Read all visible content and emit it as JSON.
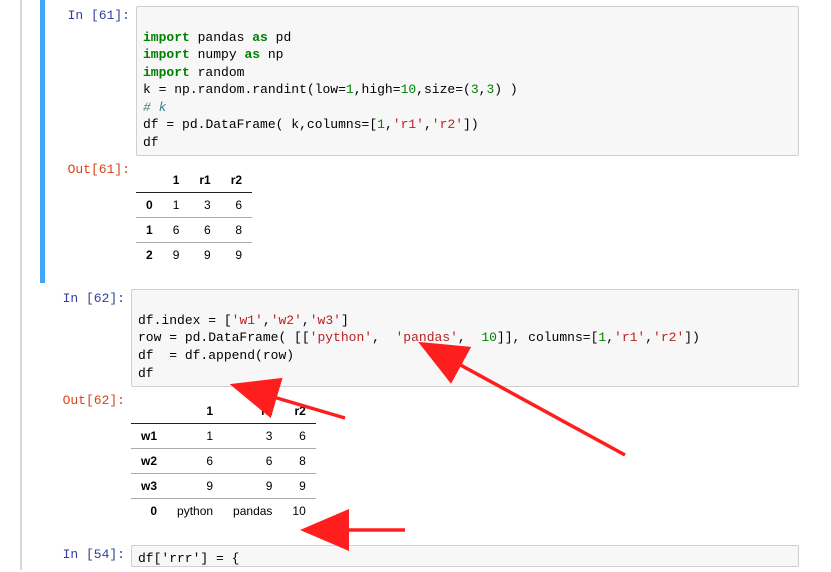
{
  "cells": {
    "c61": {
      "prompt_in": "In [61]:",
      "prompt_out": "Out[61]:"
    },
    "c62": {
      "prompt_in": "In [62]:",
      "prompt_out": "Out[62]:"
    },
    "c54": {
      "prompt_in": "In [54]:"
    }
  },
  "code61": {
    "l1_import": "import",
    "l1_pandas": "pandas",
    "l1_as": "as",
    "l1_pd": "pd",
    "l2_import": "import",
    "l2_numpy": "numpy",
    "l2_as": "as",
    "l2_np": "np",
    "l3_import": "import",
    "l3_random": "random",
    "l4_k": "k",
    "l4_eq": "=",
    "l4_call": "np.random.randint",
    "l4_lp": "(",
    "l4_low": "low",
    "l4_eq1": "=",
    "l4_lowv": "1",
    "l4_c1": ",",
    "l4_high": "high",
    "l4_eq2": "=",
    "l4_highv": "10",
    "l4_c2": ",",
    "l4_size": "size",
    "l4_eq3": "=",
    "l4_sv_lp": "(",
    "l4_sv_a": "3",
    "l4_sv_c": ",",
    "l4_sv_b": "3",
    "l4_sv_rp": ")",
    "l4_rp": " )",
    "l5_cmt": "# k",
    "l6_df": "df",
    "l6_eq": "=",
    "l6_call": "pd.DataFrame",
    "l6_lp": "( ",
    "l6_k": "k",
    "l6_c": ",",
    "l6_cols": "columns",
    "l6_eq2": "=",
    "l6_lb": "[",
    "l6_c1": "1",
    "l6_cc": ",",
    "l6_s1": "'r1'",
    "l6_cc2": ",",
    "l6_s2": "'r2'",
    "l6_rb": "]",
    "l6_rp": ")",
    "l7_df": "df"
  },
  "code62": {
    "l1_df": "df",
    "l1_dot": ".",
    "l1_idx": "index",
    "l1_eq": " = ",
    "l1_lb": "[",
    "l1_s1": "'w1'",
    "l1_c1": ",",
    "l1_s2": "'w2'",
    "l1_c2": ",",
    "l1_s3": "'w3'",
    "l1_rb": "]",
    "l2_row": "row",
    "l2_eq": " = ",
    "l2_call": "pd.DataFrame",
    "l2_lp": "( ",
    "l2_lb": "[[",
    "l2_s1": "'python'",
    "l2_c1": ", ",
    "l2_s2": " 'pandas'",
    "l2_c2": ", ",
    "l2_n": " 10",
    "l2_rb": "]]",
    "l2_c3": ",",
    "l2_cols": " columns",
    "l2_eq2": "=",
    "l2_lb2": "[",
    "l2_a": "1",
    "l2_cc": ",",
    "l2_b": "'r1'",
    "l2_cc2": ",",
    "l2_c": "'r2'",
    "l2_rb2": "]",
    "l2_rp": ")",
    "l3_df": "df",
    "l3_eq": "  = ",
    "l3_call": "df.append",
    "l3_lp": "(",
    "l3_row": "row",
    "l3_rp": ")",
    "l4_df": "df"
  },
  "code54": {
    "l1": "df['rrr'] = {"
  },
  "table61": {
    "cols": {
      "blank": "",
      "c1": "1",
      "c2": "r1",
      "c3": "r2"
    },
    "rows": [
      {
        "idx": "0",
        "a": "1",
        "b": "3",
        "c": "6"
      },
      {
        "idx": "1",
        "a": "6",
        "b": "6",
        "c": "8"
      },
      {
        "idx": "2",
        "a": "9",
        "b": "9",
        "c": "9"
      }
    ]
  },
  "table62": {
    "cols": {
      "blank": "",
      "c1": "1",
      "c2": "r1",
      "c3": "r2"
    },
    "rows": [
      {
        "idx": "w1",
        "a": "1",
        "b": "3",
        "c": "6"
      },
      {
        "idx": "w2",
        "a": "6",
        "b": "6",
        "c": "8"
      },
      {
        "idx": "w3",
        "a": "9",
        "b": "9",
        "c": "9"
      },
      {
        "idx": "0",
        "a": "python",
        "b": "pandas",
        "c": "10"
      }
    ]
  },
  "chart_data": {
    "type": "table",
    "tables": [
      {
        "columns": [
          "",
          "1",
          "r1",
          "r2"
        ],
        "data": [
          [
            "0",
            1,
            3,
            6
          ],
          [
            "1",
            6,
            6,
            8
          ],
          [
            "2",
            9,
            9,
            9
          ]
        ]
      },
      {
        "columns": [
          "",
          "1",
          "r1",
          "r2"
        ],
        "data": [
          [
            "w1",
            1,
            3,
            6
          ],
          [
            "w2",
            6,
            6,
            8
          ],
          [
            "w3",
            9,
            9,
            9
          ],
          [
            "0",
            "python",
            "pandas",
            10
          ]
        ]
      }
    ]
  },
  "colors": {
    "arrow": "#ff1e1e"
  }
}
